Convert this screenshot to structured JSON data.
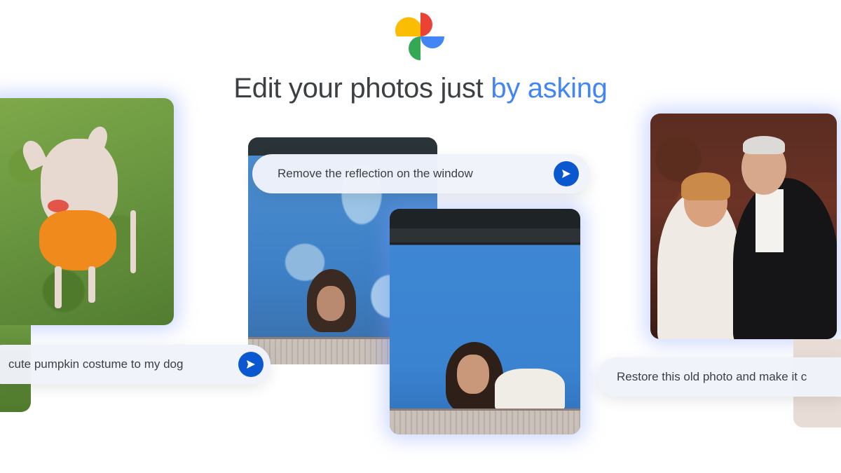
{
  "headline": {
    "plain": "Edit your photos just ",
    "accent": "by asking"
  },
  "prompts": {
    "dog": "cute pumpkin costume to my dog",
    "reflection": "Remove the reflection on the window",
    "restore": "Restore this old photo and make it c"
  },
  "icons": {
    "logo": "google-photos-pinwheel-icon",
    "send": "send-arrow-icon"
  },
  "colors": {
    "accent": "#4285f4",
    "send_button": "#0b57d0",
    "text": "#3c4043",
    "logo_red": "#ea4335",
    "logo_yellow": "#fbbc04",
    "logo_green": "#34a853",
    "logo_blue": "#4285f4"
  }
}
